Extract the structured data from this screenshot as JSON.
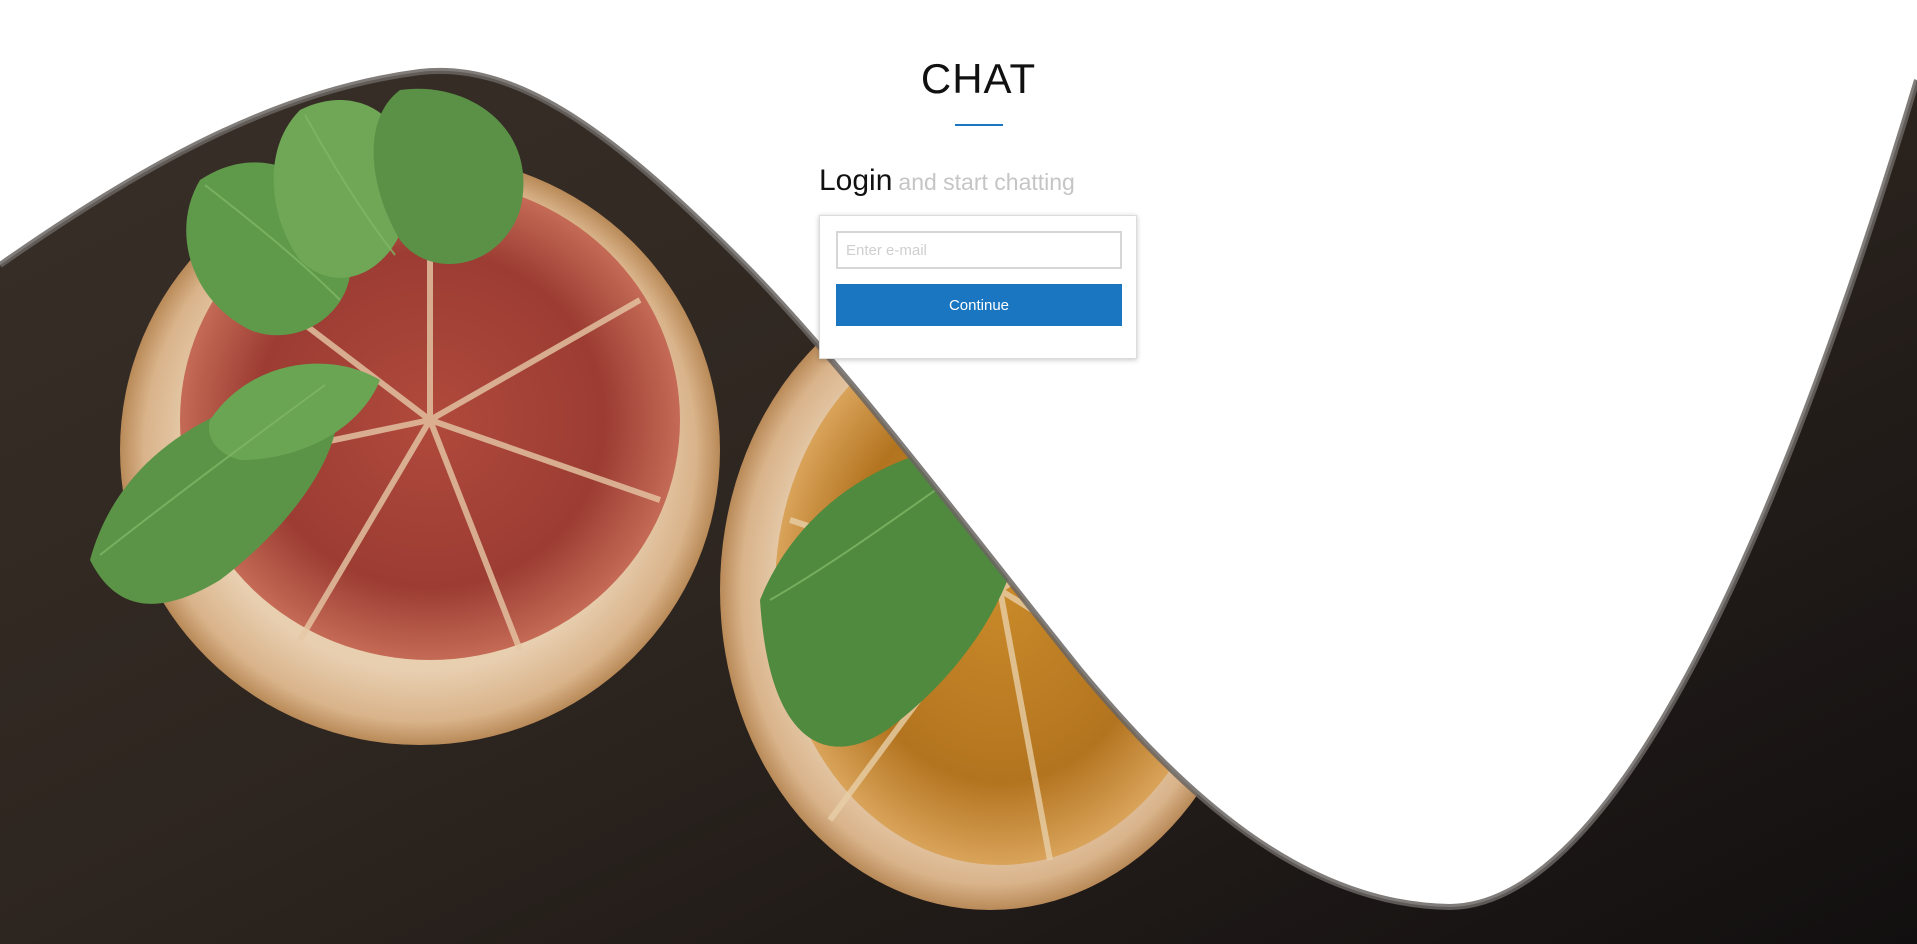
{
  "app": {
    "title": "CHAT"
  },
  "login": {
    "heading": "Login",
    "subheading": "and start chatting",
    "email_placeholder": "Enter e-mail",
    "email_value": "",
    "continue_label": "Continue"
  },
  "theme": {
    "accent": "#1a76c0",
    "background": "#ffffff",
    "photo_backdrop": "#2a231d"
  },
  "background": {
    "image_subject": "dried grapefruit and orange slices with mint leaves on a dark wooden surface"
  }
}
